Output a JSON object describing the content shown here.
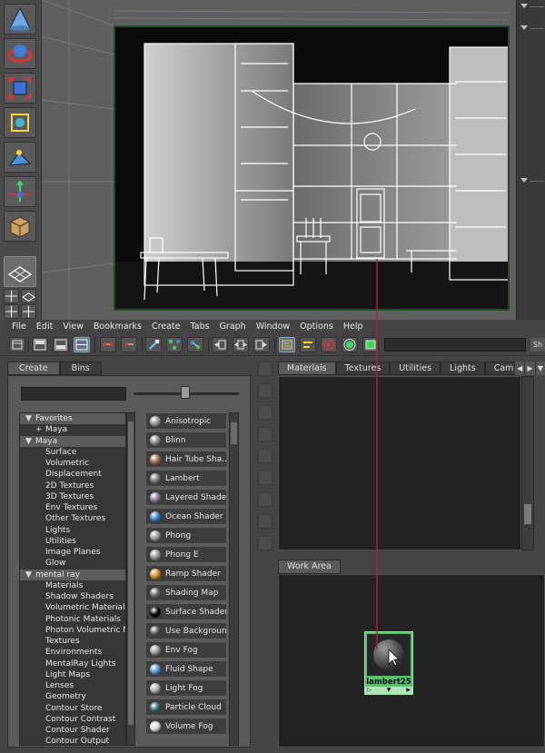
{
  "menubar": {
    "items": [
      "File",
      "Edit",
      "View",
      "Bookmarks",
      "Create",
      "Tabs",
      "Graph",
      "Window",
      "Options",
      "Help"
    ]
  },
  "toolbar": {
    "more_label": "Sh"
  },
  "create_panel": {
    "tabs": [
      "Create",
      "Bins"
    ],
    "selected_tab": "Create",
    "tree": [
      {
        "label": "Favorites",
        "level": 1,
        "expander": "▼",
        "head": true
      },
      {
        "label": "Maya",
        "level": 2,
        "expander": "+",
        "head": false
      },
      {
        "label": "Maya",
        "level": 1,
        "expander": "▼",
        "head": true
      },
      {
        "label": "Surface",
        "level": 2,
        "expander": "",
        "head": false
      },
      {
        "label": "Volumetric",
        "level": 2,
        "expander": "",
        "head": false
      },
      {
        "label": "Displacement",
        "level": 2,
        "expander": "",
        "head": false
      },
      {
        "label": "2D Textures",
        "level": 2,
        "expander": "",
        "head": false
      },
      {
        "label": "3D Textures",
        "level": 2,
        "expander": "",
        "head": false
      },
      {
        "label": "Env Textures",
        "level": 2,
        "expander": "",
        "head": false
      },
      {
        "label": "Other Textures",
        "level": 2,
        "expander": "",
        "head": false
      },
      {
        "label": "Lights",
        "level": 2,
        "expander": "",
        "head": false
      },
      {
        "label": "Utilities",
        "level": 2,
        "expander": "",
        "head": false
      },
      {
        "label": "Image Planes",
        "level": 2,
        "expander": "",
        "head": false
      },
      {
        "label": "Glow",
        "level": 2,
        "expander": "",
        "head": false
      },
      {
        "label": "mental ray",
        "level": 1,
        "expander": "▼",
        "head": true
      },
      {
        "label": "Materials",
        "level": 2,
        "expander": "",
        "head": false
      },
      {
        "label": "Shadow Shaders",
        "level": 2,
        "expander": "",
        "head": false
      },
      {
        "label": "Volumetric Materials",
        "level": 2,
        "expander": "",
        "head": false
      },
      {
        "label": "Photonic Materials",
        "level": 2,
        "expander": "",
        "head": false
      },
      {
        "label": "Photon Volumetric Ma...",
        "level": 2,
        "expander": "",
        "head": false
      },
      {
        "label": "Textures",
        "level": 2,
        "expander": "",
        "head": false
      },
      {
        "label": "Environments",
        "level": 2,
        "expander": "",
        "head": false
      },
      {
        "label": "MentalRay Lights",
        "level": 2,
        "expander": "",
        "head": false
      },
      {
        "label": "Light Maps",
        "level": 2,
        "expander": "",
        "head": false
      },
      {
        "label": "Lenses",
        "level": 2,
        "expander": "",
        "head": false
      },
      {
        "label": "Geometry",
        "level": 2,
        "expander": "",
        "head": false
      },
      {
        "label": "Contour Store",
        "level": 2,
        "expander": "",
        "head": false
      },
      {
        "label": "Contour Contrast",
        "level": 2,
        "expander": "",
        "head": false
      },
      {
        "label": "Contour Shader",
        "level": 2,
        "expander": "",
        "head": false
      },
      {
        "label": "Contour Output",
        "level": 2,
        "expander": "",
        "head": false
      }
    ],
    "shaders": [
      {
        "label": "Anisotropic",
        "color": "#9a9a9a"
      },
      {
        "label": "Blinn",
        "color": "#8c8c8c"
      },
      {
        "label": "Hair Tube Sha...",
        "color": "#a0764a"
      },
      {
        "label": "Lambert",
        "color": "#7a7a7a"
      },
      {
        "label": "Layered Shader",
        "color": "#8a7a9a"
      },
      {
        "label": "Ocean Shader",
        "color": "#3a82c8"
      },
      {
        "label": "Phong",
        "color": "#9a9a9a"
      },
      {
        "label": "Phong E",
        "color": "#9a9a9a"
      },
      {
        "label": "Ramp Shader",
        "color": "#d8902a"
      },
      {
        "label": "Shading Map",
        "color": "#6a6a6a"
      },
      {
        "label": "Surface Shader",
        "color": "#050505"
      },
      {
        "label": "Use Background",
        "color": "#5a5a5a"
      },
      {
        "label": "Env Fog",
        "color": "#9a9a9a"
      },
      {
        "label": "Fluid Shape",
        "color": "#5a9ad8"
      },
      {
        "label": "Light Fog",
        "color": "#a8a8a8"
      },
      {
        "label": "Particle Cloud",
        "color": "#2a6a6a"
      },
      {
        "label": "Volume Fog",
        "color": "#dcdcdc"
      }
    ]
  },
  "materials_panel": {
    "tabs": [
      "Materials",
      "Textures",
      "Utilities",
      "Lights",
      "Camera"
    ],
    "selected_tab": "Materials",
    "arrows": [
      "◀",
      "▶",
      "▼"
    ]
  },
  "work_area": {
    "tab_label": "Work Area",
    "node": {
      "name": "lambert25",
      "ports": [
        "▷",
        "▼",
        "▶"
      ],
      "color": "#58bf6b"
    }
  },
  "colors": {
    "connection_line": "#b3242a",
    "viewport_border": "#1f4a2a"
  }
}
